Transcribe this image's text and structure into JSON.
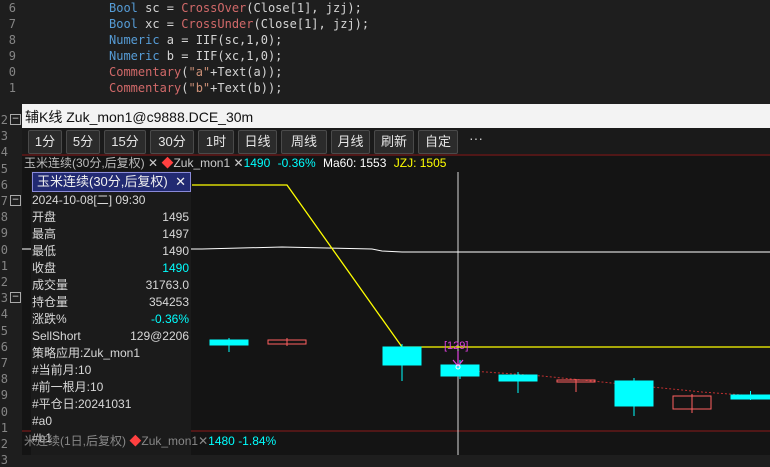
{
  "editor": {
    "lines": [
      {
        "num": "6",
        "html_parts": [
          [
            "kw",
            "Bool "
          ],
          [
            "cm",
            "sc = "
          ],
          [
            "fn",
            "CrossOver"
          ],
          [
            "cm",
            "(Close[1], jzj);"
          ]
        ]
      },
      {
        "num": "7",
        "html_parts": [
          [
            "kw",
            "Bool "
          ],
          [
            "cm",
            "xc = "
          ],
          [
            "fn",
            "CrossUnder"
          ],
          [
            "cm",
            "(Close[1], jzj);"
          ]
        ]
      },
      {
        "num": "8",
        "html_parts": [
          [
            "kw",
            "Numeric "
          ],
          [
            "cm",
            "a = IIF(sc,1,0);"
          ]
        ]
      },
      {
        "num": "9",
        "html_parts": [
          [
            "kw",
            "Numeric "
          ],
          [
            "cm",
            "b = IIF(xc,1,0);"
          ]
        ]
      },
      {
        "num": "0",
        "html_parts": [
          [
            "fn",
            "Commentary"
          ],
          [
            "cm",
            "("
          ],
          [
            "str",
            "\"a\""
          ],
          [
            "cm",
            "+Text(a));"
          ]
        ]
      },
      {
        "num": "1",
        "html_parts": [
          [
            "fn",
            "Commentary"
          ],
          [
            "cm",
            "("
          ],
          [
            "str",
            "\"b\""
          ],
          [
            "cm",
            "+Text(b));"
          ]
        ]
      }
    ],
    "gutter_numbers": [
      "2",
      "3",
      "4",
      "5",
      "6",
      "7",
      "8",
      "9",
      "0",
      "1",
      "2",
      "3",
      "4",
      "5",
      "6",
      "7",
      "8",
      "9",
      "0",
      "1",
      "2",
      "3"
    ]
  },
  "window": {
    "title": "辅K线 Zuk_mon1@c9888.DCE_30m"
  },
  "toolbar": {
    "buttons": [
      "1分",
      "5分",
      "15分",
      "30分",
      "1时",
      "日线",
      "周线",
      "月线",
      "刷新",
      "自定"
    ],
    "more": "···"
  },
  "legend": {
    "contract": "玉米连续(30分,后复权)",
    "close_x": "✕",
    "strategy": "Zuk_mon1",
    "price": "1490",
    "change": "-0.36%",
    "ma_label": "Ma60:",
    "ma_value": "1553",
    "jzj_label": "JZJ:",
    "jzj_value": "1505"
  },
  "info_panel": {
    "title": "玉米连续(30分,后复权)",
    "close": "✕",
    "datetime": "2024-10-08[二] 09:30",
    "rows": [
      {
        "label": "开盘",
        "value": "1495"
      },
      {
        "label": "最高",
        "value": "1497"
      },
      {
        "label": "最低",
        "value": "1490"
      },
      {
        "label": "收盘",
        "value": "1490"
      },
      {
        "label": "成交量",
        "value": "31763.0"
      },
      {
        "label": "持仓量",
        "value": "354253"
      },
      {
        "label": "涨跌%",
        "value": "-0.36%"
      },
      {
        "label": "SellShort",
        "value": "129@2206"
      }
    ],
    "notes": [
      "策略应用:Zuk_mon1",
      "#当前月:10",
      "#前一根月:10",
      "#平仓日:20241031",
      "#a0",
      "#b1"
    ]
  },
  "chart_marker": "[129]",
  "bottom_legend": {
    "contract": "米连续(1日,后复权)",
    "strategy": "Zuk_mon1",
    "price": "1480",
    "change": "-1.84%"
  },
  "colors": {
    "up": "#00ffff",
    "down": "#ff6060",
    "jzj": "#ffff00",
    "ma": "#ffffff",
    "marker": "#e040e0"
  }
}
